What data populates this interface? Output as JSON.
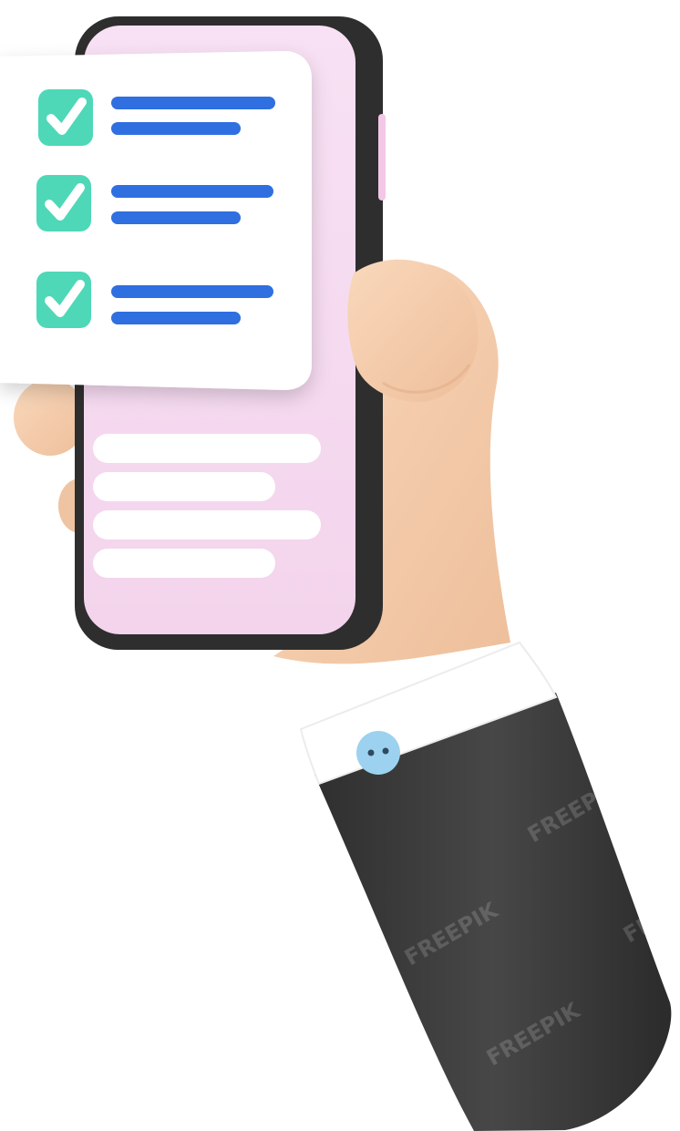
{
  "illustration": {
    "subject": "hand-holding-smartphone-with-checklist",
    "checklist": {
      "items": [
        {
          "checked": true
        },
        {
          "checked": true
        },
        {
          "checked": true
        }
      ],
      "check_color": "#4ed8b8",
      "line_color": "#2f6fe0"
    },
    "phone": {
      "frame_color": "#2e2e2e",
      "screen_color": "#f6dcf1",
      "placeholder_rows": 4
    },
    "hand": {
      "skin_color": "#f6cfae",
      "shadow_color": "#e7b38f"
    },
    "sleeve": {
      "jacket_color": "#3a3a3a",
      "cuff_color": "#ffffff",
      "button_color": "#9cd2ef"
    },
    "watermark": "FREEPIK"
  }
}
